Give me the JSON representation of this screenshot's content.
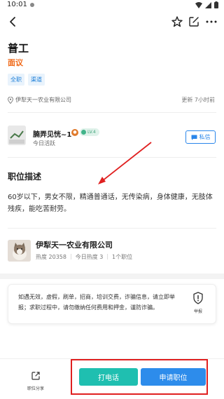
{
  "status_bar": {
    "time": "10:01"
  },
  "job": {
    "title": "普工",
    "salary": "面议",
    "tags": [
      "全职",
      "渠道"
    ],
    "company": "伊犁天一农业有限公司",
    "updated": "更新 7小时前"
  },
  "recruiter": {
    "name": "腩弄见恍~1",
    "level": "LV.4",
    "active": "今日活跃",
    "message_button": "私信"
  },
  "description": {
    "heading": "职位描述",
    "text": "60岁以下，男女不限，精通普通话，无传染病，身体健康，无肢体残疾，能吃苦耐劳。"
  },
  "company_card": {
    "name": "伊犁天一农业有限公司",
    "heat": "热度 20358",
    "today_heat": "今日热度 3",
    "positions": "1个职位"
  },
  "notice": {
    "text": "如遇无效，虚假，刷单，招商，培训交费，诈骗信息，请立即举报；求职过程中，请勿缴纳任何费用和押金，谨防诈骗。",
    "report_label": "举报"
  },
  "bottom_bar": {
    "share_label": "职位分享",
    "call_button": "打电话",
    "apply_button": "申请职位"
  },
  "colors": {
    "salary": "#f06a1a",
    "tag": "#1e7fd8",
    "call": "#1fbfb0",
    "apply": "#2d8ceb",
    "annotation": "#e02020"
  }
}
